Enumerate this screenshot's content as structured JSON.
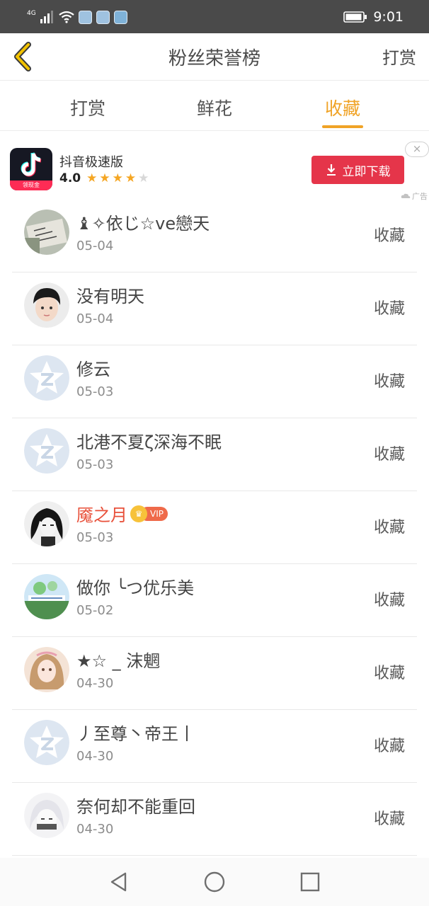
{
  "status_bar": {
    "network": "4G",
    "time": "9:01"
  },
  "header": {
    "title": "粉丝荣誉榜",
    "action": "打赏"
  },
  "tabs": [
    {
      "label": "打赏"
    },
    {
      "label": "鲜花"
    },
    {
      "label": "收藏"
    }
  ],
  "active_tab": "收藏",
  "ad": {
    "app_name": "抖音极速版",
    "rating": "4.0",
    "stars_filled": 4,
    "stars_total": 5,
    "download_label": "立即下载",
    "ad_label": "广告",
    "icon_tag": "领现金",
    "close_glyph": "×"
  },
  "list": [
    {
      "name": "♝✧依じ☆ve戀天",
      "date": "05-04",
      "action": "收藏",
      "avatar": "handwriting-avatar",
      "vip": false
    },
    {
      "name": "没有明天",
      "date": "05-04",
      "action": "收藏",
      "avatar": "boy-photo-avatar",
      "vip": false
    },
    {
      "name": "修云",
      "date": "05-03",
      "action": "收藏",
      "avatar": "default-avatar",
      "vip": false
    },
    {
      "name": "北港不夏ζ深海不眠",
      "date": "05-03",
      "action": "收藏",
      "avatar": "default-avatar",
      "vip": false
    },
    {
      "name": "魇之月",
      "date": "05-03",
      "action": "收藏",
      "avatar": "anime-dark-avatar",
      "vip": true,
      "vip_label": "VIP"
    },
    {
      "name": "做你 ╰つ优乐美",
      "date": "05-02",
      "action": "收藏",
      "avatar": "landscape-avatar",
      "vip": false
    },
    {
      "name": "★☆ _ 沫魍",
      "date": "04-30",
      "action": "收藏",
      "avatar": "girl-photo-avatar",
      "vip": false
    },
    {
      "name": "丿至尊丶帝王丨",
      "date": "04-30",
      "action": "收藏",
      "avatar": "default-avatar",
      "vip": false
    },
    {
      "name": "奈何却不能重回",
      "date": "04-30",
      "action": "收藏",
      "avatar": "anime-light-avatar",
      "vip": false
    }
  ],
  "colors": {
    "accent": "#f0a326",
    "vip_name": "#e8503a",
    "download_button": "#e5354a",
    "status_bar": "#4a4a4a",
    "star": "#f5a623"
  }
}
